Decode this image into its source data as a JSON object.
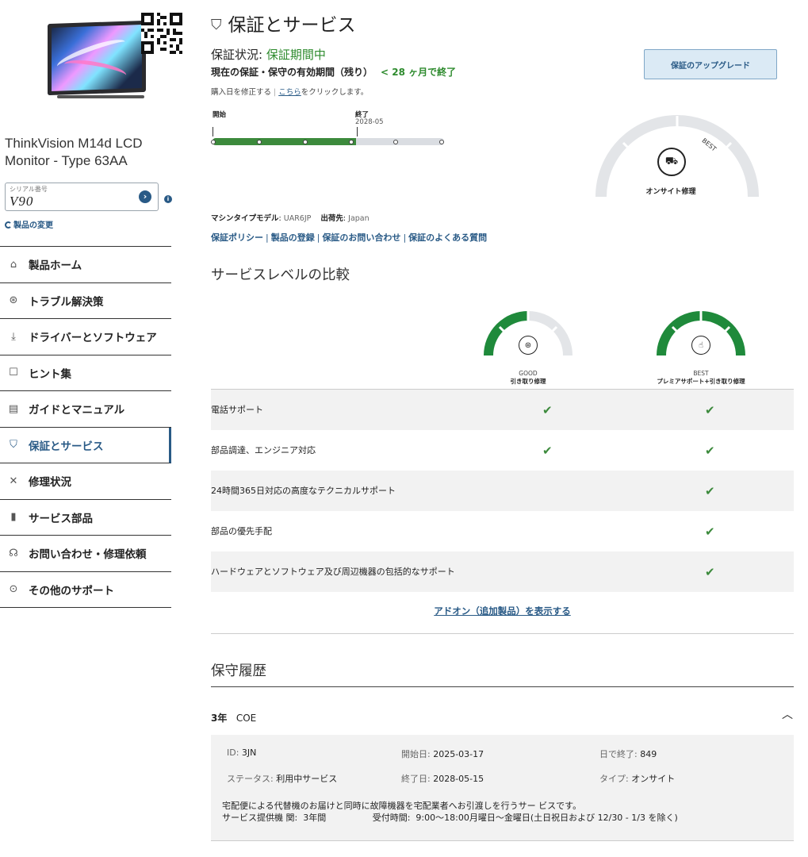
{
  "sidebar": {
    "product_name": "ThinkVision M14d LCD Monitor - Type 63AA",
    "serial_label": "シリアル番号",
    "serial_value": "V90",
    "change_product": "製品の変更",
    "nav": [
      {
        "label": "製品ホーム",
        "icon": "home-icon",
        "glyph": "⌂"
      },
      {
        "label": "トラブル解決策",
        "icon": "share-icon",
        "glyph": "⊛"
      },
      {
        "label": "ドライバーとソフトウェア",
        "icon": "download-icon",
        "glyph": "⤓"
      },
      {
        "label": "ヒント集",
        "icon": "book-icon",
        "glyph": "☐"
      },
      {
        "label": "ガイドとマニュアル",
        "icon": "manual-icon",
        "glyph": "▤"
      },
      {
        "label": "保証とサービス",
        "icon": "shield-icon",
        "glyph": "⛉",
        "active": true
      },
      {
        "label": "修理状況",
        "icon": "tools-icon",
        "glyph": "✕"
      },
      {
        "label": "サービス部品",
        "icon": "battery-icon",
        "glyph": "▮"
      },
      {
        "label": "お問い合わせ・修理依頼",
        "icon": "headset-icon",
        "glyph": "☊"
      },
      {
        "label": "その他のサポート",
        "icon": "more-icon",
        "glyph": "⊙"
      }
    ]
  },
  "main": {
    "title": "保証とサービス",
    "status_label": "保証状況: ",
    "status_value": "保証期間中",
    "remaining_label": "現在の保証・保守の有効期間（残り）",
    "remaining_value": "< 28 ヶ月で終了",
    "modify_prefix": "購入日を修正する",
    "modify_link": "こちら",
    "modify_suffix": "をクリックします。",
    "upgrade_button": "保証のアップグレード",
    "timeline": {
      "start_label": "開始",
      "end_label": "終了",
      "end_date": "2028-05",
      "elapsed_fraction": 0.62
    },
    "current_level": {
      "label": "オンサイト修理",
      "tier": "BEST",
      "icon": "onsite-truck-icon"
    },
    "machine_model_label": "マシンタイプモデル",
    "machine_model_value": "UAR6JP",
    "ship_to_label": "出荷先",
    "ship_to_value": "Japan",
    "links": [
      "保証ポリシー",
      "製品の登録",
      "保証のお問い合わせ",
      "保証のよくある質問"
    ],
    "comparison_title": "サービスレベルの比較",
    "comparison_columns": [
      {
        "tier": "GOOD",
        "name": "引き取り修理",
        "icon": "pickup-icon",
        "level_fraction": 0.5
      },
      {
        "tier": "BEST",
        "name": "プレミアサポート+引き取り修理",
        "icon": "premier-icon",
        "level_fraction": 1.0
      }
    ],
    "comparison_rows": [
      {
        "feature": "電話サポート",
        "good": true,
        "best": true
      },
      {
        "feature": "部品調達、エンジニア対応",
        "good": true,
        "best": true
      },
      {
        "feature": "24時間365日対応の高度なテクニカルサポート",
        "good": false,
        "best": true
      },
      {
        "feature": "部品の優先手配",
        "good": false,
        "best": true
      },
      {
        "feature": "ハードウェアとソフトウェア及び周辺機器の包括的なサポート",
        "good": false,
        "best": true
      }
    ],
    "addon_link": "アドオン（追加製品）を表示する",
    "history_title": "保守履歴",
    "history": {
      "term": "3年",
      "type_code": "COE",
      "id_label": "ID: ",
      "id_value": "3JN",
      "start_label": "開始日: ",
      "start_value": "2025-03-17",
      "days_label": "日で終了: ",
      "days_value": "849",
      "status_label": "ステータス: ",
      "status_value": "利用中サービス",
      "end_label": "終了日: ",
      "end_value": "2028-05-15",
      "kind_label": "タイプ: ",
      "kind_value": "オンサイト",
      "description": "宅配便による代替機のお届けと同時に故障機器を宅配業者へお引渡しを行うサー ビスです。",
      "period_label": "サービス提供機 関:",
      "period_value": "3年間",
      "hours_label": "受付時間:",
      "hours_value": "9:00〜18:00月曜日〜金曜日(土日祝日および 12/30 - 1/3 を除く)"
    }
  },
  "colors": {
    "accent": "#295a86",
    "green": "#2e8b2e",
    "gauge_green": "#1f8a3b",
    "gauge_grey": "#e3e5e8"
  }
}
